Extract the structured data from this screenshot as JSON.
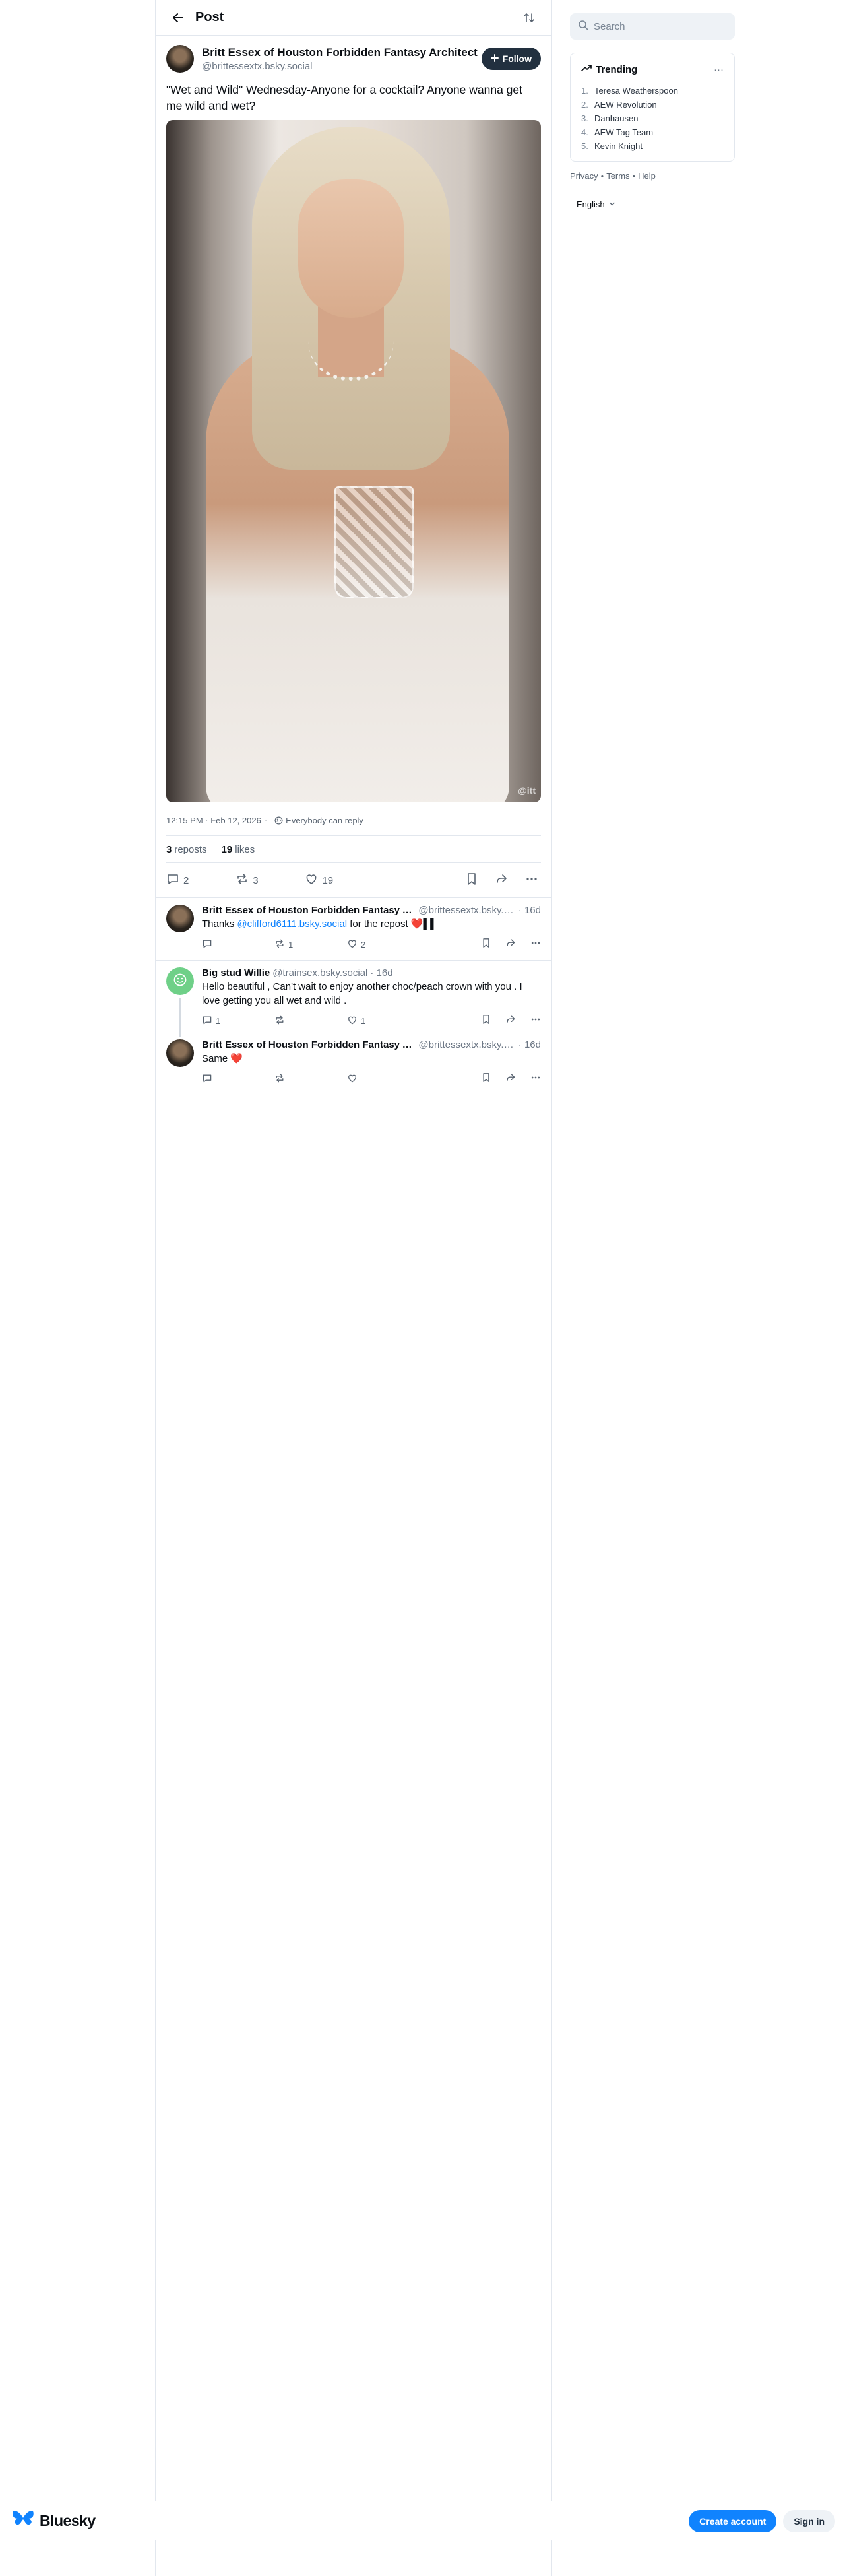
{
  "header": {
    "title": "Post"
  },
  "post": {
    "author_name": "Britt Essex of Houston Forbidden Fantasy Architect",
    "author_handle": "@brittessextx.bsky.social",
    "follow_label": "Follow",
    "text": "\"Wet and Wild\" Wednesday-Anyone for a cocktail? Anyone wanna get me wild and wet?",
    "image_watermark": "@itt",
    "timestamp": "12:15 PM · Feb 12, 2026",
    "reply_setting": "Everybody can reply",
    "reposts_count": "3",
    "reposts_label": "reposts",
    "likes_count": "19",
    "likes_label": "likes",
    "reply_count": "2",
    "repost_count": "3",
    "like_count": "19"
  },
  "replies": [
    {
      "name": "Britt Essex of Houston Forbidden Fantasy Architect",
      "handle": "@brittessextx.bsky.social",
      "time": "· 16d",
      "text_before": "Thanks ",
      "mention": "@clifford6111.bsky.social",
      "text_after": " for the repost ❤️▌▌",
      "reply_count": "",
      "repost_count": "1",
      "like_count": "2"
    },
    {
      "name": "Big stud Willie",
      "handle": "@trainsex.bsky.social",
      "time": "· 16d",
      "text": "Hello beautiful , Can't wait to enjoy another choc/peach crown with you . I love getting you all wet and wild .",
      "reply_count": "1",
      "repost_count": "",
      "like_count": "1"
    },
    {
      "name": "Britt Essex of Houston Forbidden Fantasy Architect",
      "handle": "@brittessextx.bsky.social",
      "time": "· 16d",
      "text": "Same ❤️",
      "reply_count": "",
      "repost_count": "",
      "like_count": ""
    }
  ],
  "sidebar": {
    "search_placeholder": "Search",
    "trending_title": "Trending",
    "trending_more": "···",
    "trending": [
      {
        "num": "1.",
        "label": "Teresa Weatherspoon"
      },
      {
        "num": "2.",
        "label": "AEW Revolution"
      },
      {
        "num": "3.",
        "label": "Danhausen"
      },
      {
        "num": "4.",
        "label": "AEW Tag Team"
      },
      {
        "num": "5.",
        "label": "Kevin Knight"
      }
    ],
    "links": {
      "privacy": "Privacy",
      "sep": "•",
      "terms": "Terms",
      "help": "Help"
    },
    "language": "English"
  },
  "footer": {
    "brand": "Bluesky",
    "create_account": "Create account",
    "sign_in": "Sign in"
  },
  "colors": {
    "accent": "#1083fe",
    "follow_bg": "#22303f",
    "border": "#e2e7ee",
    "muted": "#6b7684"
  }
}
